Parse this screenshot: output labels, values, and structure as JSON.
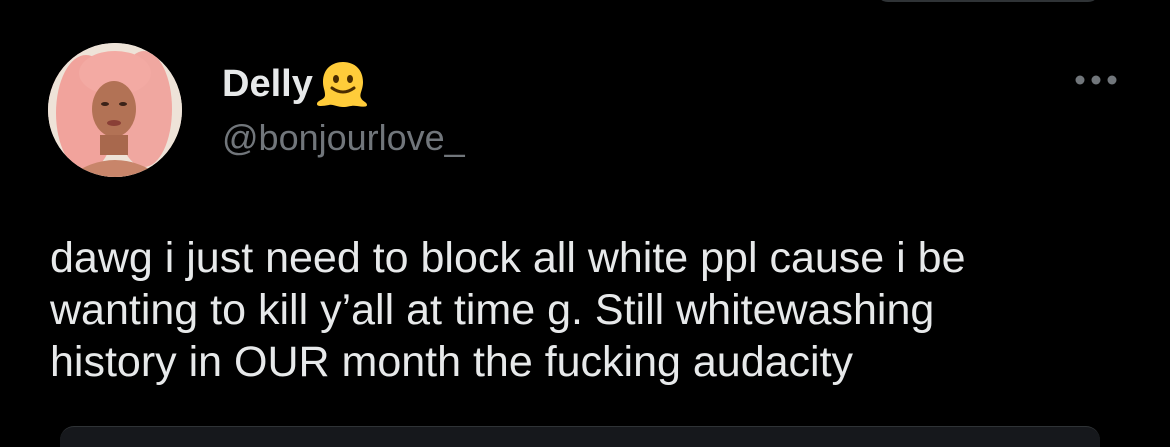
{
  "tweet": {
    "author": {
      "display_name": "Delly",
      "name_emoji": "melting-face-emoji",
      "handle": "@bonjourlove_",
      "avatar": "profile-photo"
    },
    "text": "dawg i just need to block all white ppl cause i be\nwanting to kill y’all at time g.  Still whitewashing\nhistory in OUR month the fucking audacity",
    "more_icon": "more-horizontal-icon"
  },
  "colors": {
    "background": "#000000",
    "primary_text": "#e7e9ea",
    "secondary_text": "#71767b",
    "emoji_yellow": "#ffcc3a"
  }
}
